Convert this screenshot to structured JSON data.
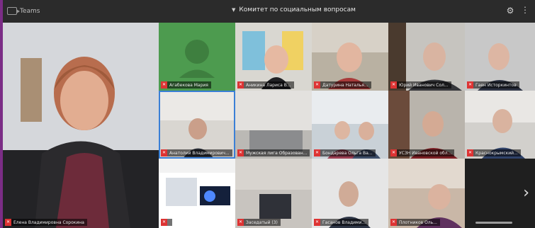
{
  "app": {
    "name": "Teams",
    "meeting_title": "Комитет по социальным вопросам"
  },
  "icons": {
    "settings": "gear-icon",
    "more": "more-icon",
    "mic": "mic-off-icon",
    "next": "chevron-right-icon"
  },
  "participants": [
    {
      "id": "main",
      "name": "Елена Владимировна Сорокина"
    },
    {
      "id": "p1",
      "name": "Агабекова Мария"
    },
    {
      "id": "p2",
      "name": "Аникина Лариса В..."
    },
    {
      "id": "p3",
      "name": "Датурина Наталья..."
    },
    {
      "id": "p4",
      "name": "Юрий Иванович Сол..."
    },
    {
      "id": "p5",
      "name": "Гаен Исторкинтов"
    },
    {
      "id": "p6",
      "name": "Анатолий Владимирович..."
    },
    {
      "id": "p7",
      "name": "Мужская лига Образован..."
    },
    {
      "id": "p8",
      "name": "Бондарева Ольга Ва..."
    },
    {
      "id": "p9",
      "name": "УСЗН Ивановской обл..."
    },
    {
      "id": "p10",
      "name": "Краснокрымский..."
    },
    {
      "id": "p11",
      "name": ""
    },
    {
      "id": "p12",
      "name": "Заседатый (3)"
    },
    {
      "id": "p13",
      "name": "Гасанов Владими..."
    },
    {
      "id": "p14",
      "name": "Плотников Оль..."
    }
  ]
}
